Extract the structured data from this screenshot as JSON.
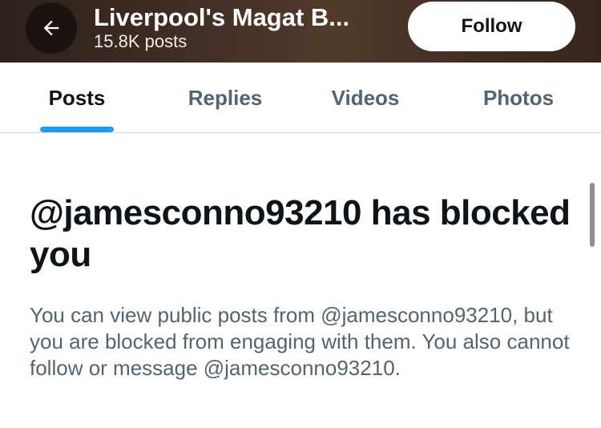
{
  "header": {
    "title": "Liverpool's Magat B...",
    "post_count": "15.8K posts",
    "back_icon": "arrow-left-icon",
    "follow_label": "Follow"
  },
  "tabs": [
    {
      "label": "Posts",
      "active": true
    },
    {
      "label": "Replies",
      "active": false
    },
    {
      "label": "Videos",
      "active": false
    },
    {
      "label": "Photos",
      "active": false
    }
  ],
  "blocked_notice": {
    "heading": "@jamesconno93210 has blocked you",
    "body": "You can view public posts from @jamesconno93210, but you are blocked from engaging with them. You also cannot follow or message @jamesconno93210."
  },
  "colors": {
    "accent": "#1d9bf0",
    "text_primary": "#0f1419",
    "text_secondary": "#536471"
  }
}
